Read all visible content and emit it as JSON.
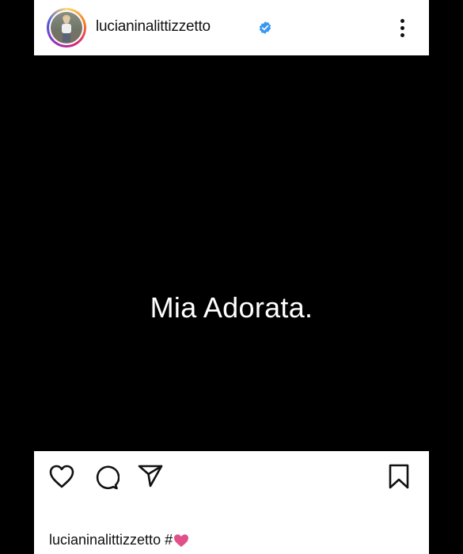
{
  "header": {
    "username": "lucianinalittizzetto",
    "verified": true,
    "avatar_icon": "profile-photo",
    "more_icon": "more-vertical-icon"
  },
  "post": {
    "text": "Mia Adorata.",
    "background": "#000000",
    "text_color": "#ffffff"
  },
  "actions": {
    "icons": [
      "heart-icon",
      "comment-icon",
      "share-icon",
      "bookmark-icon"
    ]
  },
  "caption": {
    "username": "lucianinalittizzetto",
    "hash": "#",
    "heart_color": "#e0508a"
  },
  "colors": {
    "verified_blue": "#3897f0"
  }
}
